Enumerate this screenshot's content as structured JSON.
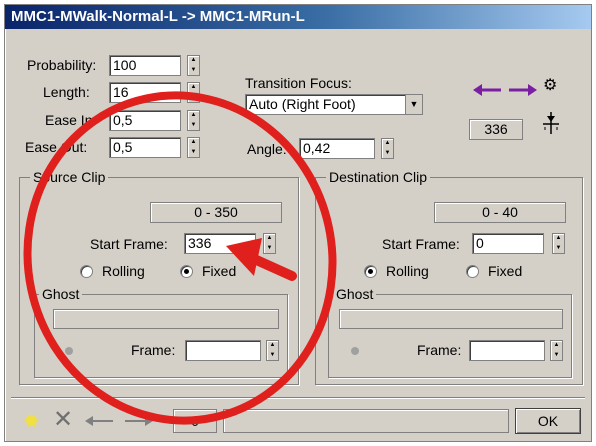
{
  "window": {
    "title": "MMC1-MWalk-Normal-L -> MMC1-MRun-L"
  },
  "params": {
    "probability": {
      "label": "Probability:",
      "value": "100"
    },
    "length": {
      "label": "Length:",
      "value": "16"
    },
    "ease_in": {
      "label": "Ease In:",
      "value": "0,5"
    },
    "ease_out": {
      "label": "Ease Out:",
      "value": "0,5"
    }
  },
  "transition": {
    "focus_label": "Transition Focus:",
    "focus_value": "Auto (Right Foot)",
    "angle_label": "Angle:",
    "angle_value": "0,42",
    "frame_readout": "336"
  },
  "source_clip": {
    "title": "Source Clip",
    "range": "0 - 350",
    "start_frame_label": "Start Frame:",
    "start_frame_value": "336",
    "rolling_label": "Rolling",
    "fixed_label": "Fixed",
    "selected": "Fixed",
    "ghost_title": "Ghost",
    "ghost_frame_label": "Frame:"
  },
  "destination_clip": {
    "title": "Destination Clip",
    "range": "0 - 40",
    "start_frame_label": "Start Frame:",
    "start_frame_value": "0",
    "rolling_label": "Rolling",
    "fixed_label": "Fixed",
    "selected": "Rolling",
    "ghost_title": "Ghost",
    "ghost_frame_label": "Frame:"
  },
  "bottom": {
    "counter": "0",
    "ok_label": "OK"
  },
  "annotation": {
    "color": "#e0201c"
  },
  "icons": [
    "arrow-left-icon",
    "arrow-right-icon",
    "gears-icon",
    "pin-icon",
    "sparkle-icon",
    "cross-icon"
  ]
}
